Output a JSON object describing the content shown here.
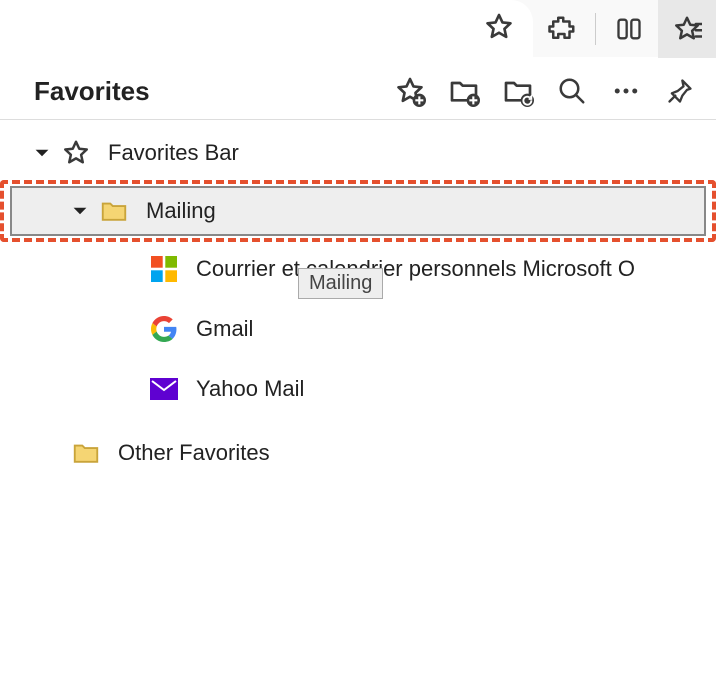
{
  "panel": {
    "title": "Favorites"
  },
  "tree": {
    "favoritesBar": "Favorites Bar",
    "mailing": "Mailing",
    "items": [
      "Courrier et calendrier personnels Microsoft O",
      "Gmail",
      "Yahoo Mail"
    ],
    "otherFavorites": "Other Favorites"
  },
  "tooltip": "Mailing"
}
